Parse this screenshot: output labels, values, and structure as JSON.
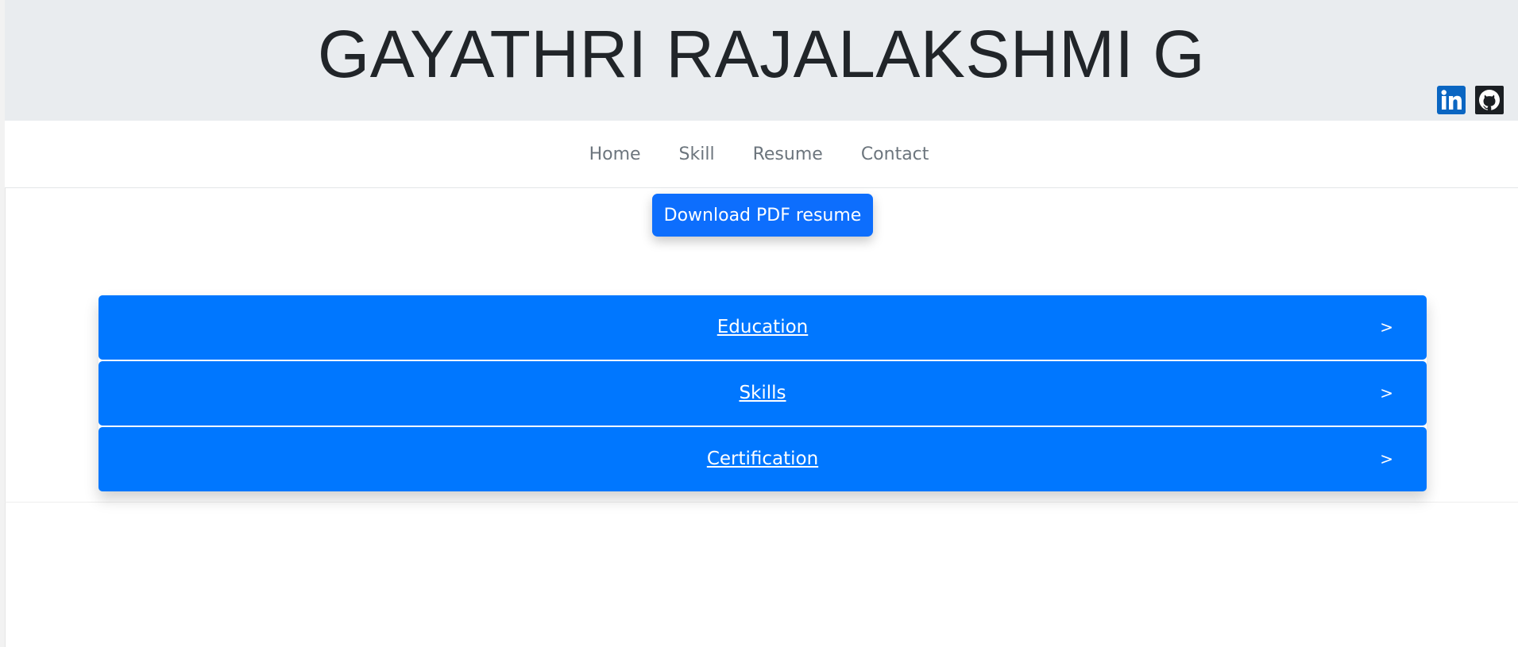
{
  "header": {
    "title": "GAYATHRI RAJALAKSHMI G",
    "background_color": "#e9ecef",
    "social": [
      {
        "name": "linkedin-icon",
        "color": "#0a66c2"
      },
      {
        "name": "github-icon",
        "color": "#1b1f23"
      }
    ]
  },
  "nav": {
    "items": [
      {
        "label": "Home"
      },
      {
        "label": "Skill"
      },
      {
        "label": "Resume"
      },
      {
        "label": "Contact"
      }
    ],
    "text_color": "#6c757d"
  },
  "download": {
    "label": "Download PDF resume",
    "color": "#0d6efd"
  },
  "accordion": {
    "color": "#0077ff",
    "items": [
      {
        "label": "Education",
        "chevron": ">"
      },
      {
        "label": "Skills",
        "chevron": ">"
      },
      {
        "label": "Certification",
        "chevron": ">"
      }
    ]
  }
}
